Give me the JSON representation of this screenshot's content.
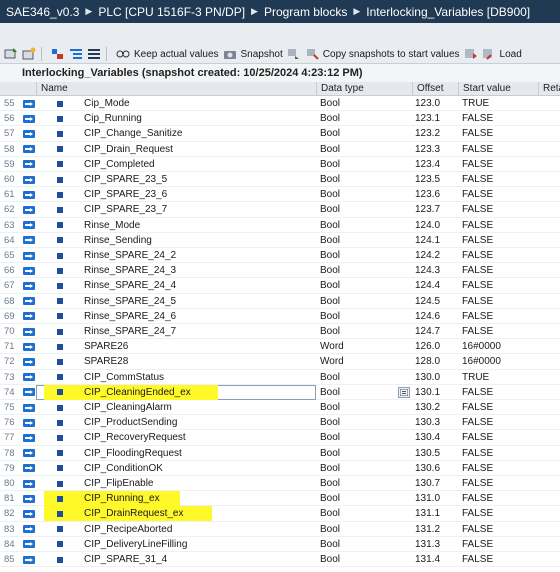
{
  "breadcrumb": [
    "SAE346_v0.3",
    "PLC [CPU 1516F-3 PN/DP]",
    "Program blocks",
    "Interlocking_Variables [DB900]"
  ],
  "toolbar": {
    "keep_actual_values": "Keep actual values",
    "snapshot": "Snapshot",
    "copy_snapshots": "Copy snapshots to start values",
    "load": "Load"
  },
  "title": "Interlocking_Variables (snapshot created: 10/25/2024 4:23:12 PM)",
  "columns": {
    "name": "Name",
    "data_type": "Data type",
    "offset": "Offset",
    "start_value": "Start value",
    "retain": "Reta"
  },
  "rows": [
    {
      "num": "55",
      "name": "Cip_Mode",
      "type": "Bool",
      "offset": "123.0",
      "start": "TRUE"
    },
    {
      "num": "56",
      "name": "Cip_Running",
      "type": "Bool",
      "offset": "123.1",
      "start": "FALSE"
    },
    {
      "num": "57",
      "name": "CIP_Change_Sanitize",
      "type": "Bool",
      "offset": "123.2",
      "start": "FALSE"
    },
    {
      "num": "58",
      "name": "CIP_Drain_Request",
      "type": "Bool",
      "offset": "123.3",
      "start": "FALSE"
    },
    {
      "num": "59",
      "name": "CIP_Completed",
      "type": "Bool",
      "offset": "123.4",
      "start": "FALSE"
    },
    {
      "num": "60",
      "name": "CIP_SPARE_23_5",
      "type": "Bool",
      "offset": "123.5",
      "start": "FALSE"
    },
    {
      "num": "61",
      "name": "CIP_SPARE_23_6",
      "type": "Bool",
      "offset": "123.6",
      "start": "FALSE"
    },
    {
      "num": "62",
      "name": "CIP_SPARE_23_7",
      "type": "Bool",
      "offset": "123.7",
      "start": "FALSE"
    },
    {
      "num": "63",
      "name": "Rinse_Mode",
      "type": "Bool",
      "offset": "124.0",
      "start": "FALSE"
    },
    {
      "num": "64",
      "name": "Rinse_Sending",
      "type": "Bool",
      "offset": "124.1",
      "start": "FALSE"
    },
    {
      "num": "65",
      "name": "Rinse_SPARE_24_2",
      "type": "Bool",
      "offset": "124.2",
      "start": "FALSE"
    },
    {
      "num": "66",
      "name": "Rinse_SPARE_24_3",
      "type": "Bool",
      "offset": "124.3",
      "start": "FALSE"
    },
    {
      "num": "67",
      "name": "Rinse_SPARE_24_4",
      "type": "Bool",
      "offset": "124.4",
      "start": "FALSE"
    },
    {
      "num": "68",
      "name": "Rinse_SPARE_24_5",
      "type": "Bool",
      "offset": "124.5",
      "start": "FALSE"
    },
    {
      "num": "69",
      "name": "Rinse_SPARE_24_6",
      "type": "Bool",
      "offset": "124.6",
      "start": "FALSE"
    },
    {
      "num": "70",
      "name": "Rinse_SPARE_24_7",
      "type": "Bool",
      "offset": "124.7",
      "start": "FALSE"
    },
    {
      "num": "71",
      "name": "SPARE26",
      "type": "Word",
      "offset": "126.0",
      "start": "16#0000"
    },
    {
      "num": "72",
      "name": "SPARE28",
      "type": "Word",
      "offset": "128.0",
      "start": "16#0000"
    },
    {
      "num": "73",
      "name": "CIP_CommStatus",
      "type": "Bool",
      "offset": "130.0",
      "start": "TRUE"
    },
    {
      "num": "74",
      "name": "CIP_CleaningEnded_ex",
      "type": "Bool",
      "offset": "130.1",
      "start": "FALSE",
      "highlight": true,
      "selected": true
    },
    {
      "num": "75",
      "name": "CIP_CleaningAlarm",
      "type": "Bool",
      "offset": "130.2",
      "start": "FALSE"
    },
    {
      "num": "76",
      "name": "CIP_ProductSending",
      "type": "Bool",
      "offset": "130.3",
      "start": "FALSE"
    },
    {
      "num": "77",
      "name": "CIP_RecoveryRequest",
      "type": "Bool",
      "offset": "130.4",
      "start": "FALSE"
    },
    {
      "num": "78",
      "name": "CIP_FloodingRequest",
      "type": "Bool",
      "offset": "130.5",
      "start": "FALSE"
    },
    {
      "num": "79",
      "name": "CIP_ConditionOK",
      "type": "Bool",
      "offset": "130.6",
      "start": "FALSE"
    },
    {
      "num": "80",
      "name": "CIP_FlipEnable",
      "type": "Bool",
      "offset": "130.7",
      "start": "FALSE"
    },
    {
      "num": "81",
      "name": "CIP_Running_ex",
      "type": "Bool",
      "offset": "131.0",
      "start": "FALSE",
      "highlight": true
    },
    {
      "num": "82",
      "name": "CIP_DrainRequest_ex",
      "type": "Bool",
      "offset": "131.1",
      "start": "FALSE",
      "highlight": true
    },
    {
      "num": "83",
      "name": "CIP_RecipeAborted",
      "type": "Bool",
      "offset": "131.2",
      "start": "FALSE"
    },
    {
      "num": "84",
      "name": "CIP_DeliveryLineFilling",
      "type": "Bool",
      "offset": "131.3",
      "start": "FALSE"
    },
    {
      "num": "85",
      "name": "CIP_SPARE_31_4",
      "type": "Bool",
      "offset": "131.4",
      "start": "FALSE"
    }
  ],
  "colors": {
    "breadcrumb_bg": "#203a54",
    "highlight": "#fff92a",
    "interface_icon": "#1f6fd1"
  }
}
